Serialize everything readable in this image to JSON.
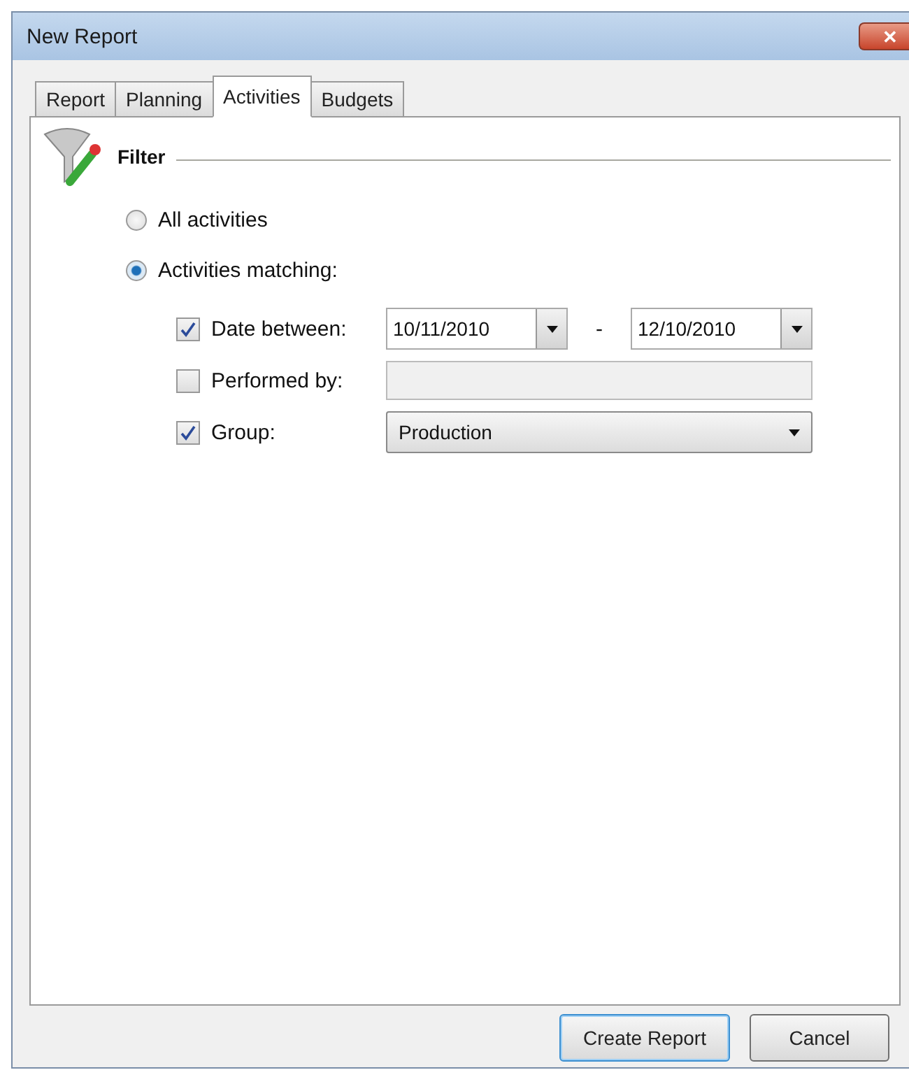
{
  "window": {
    "title": "New Report",
    "close": "✕"
  },
  "tabs": [
    {
      "label": "Report",
      "selected": false
    },
    {
      "label": "Planning",
      "selected": false
    },
    {
      "label": "Activities",
      "selected": true
    },
    {
      "label": "Budgets",
      "selected": false
    }
  ],
  "section": {
    "title": "Filter"
  },
  "scope": [
    {
      "label": "All activities",
      "selected": false
    },
    {
      "label": "Activities matching:",
      "selected": true
    }
  ],
  "criteria": [
    {
      "kind": "date_range",
      "label": "Date between:",
      "checked": true,
      "from": "10/11/2010",
      "separator": "-",
      "to": "12/10/2010"
    },
    {
      "kind": "text",
      "label": "Performed by:",
      "checked": false,
      "disabled": true
    },
    {
      "kind": "dropdown",
      "label": "Group:",
      "checked": true,
      "value": "Production"
    }
  ],
  "buttons": [
    {
      "label": "Create Report",
      "default": true
    },
    {
      "label": "Cancel",
      "default": false
    }
  ]
}
